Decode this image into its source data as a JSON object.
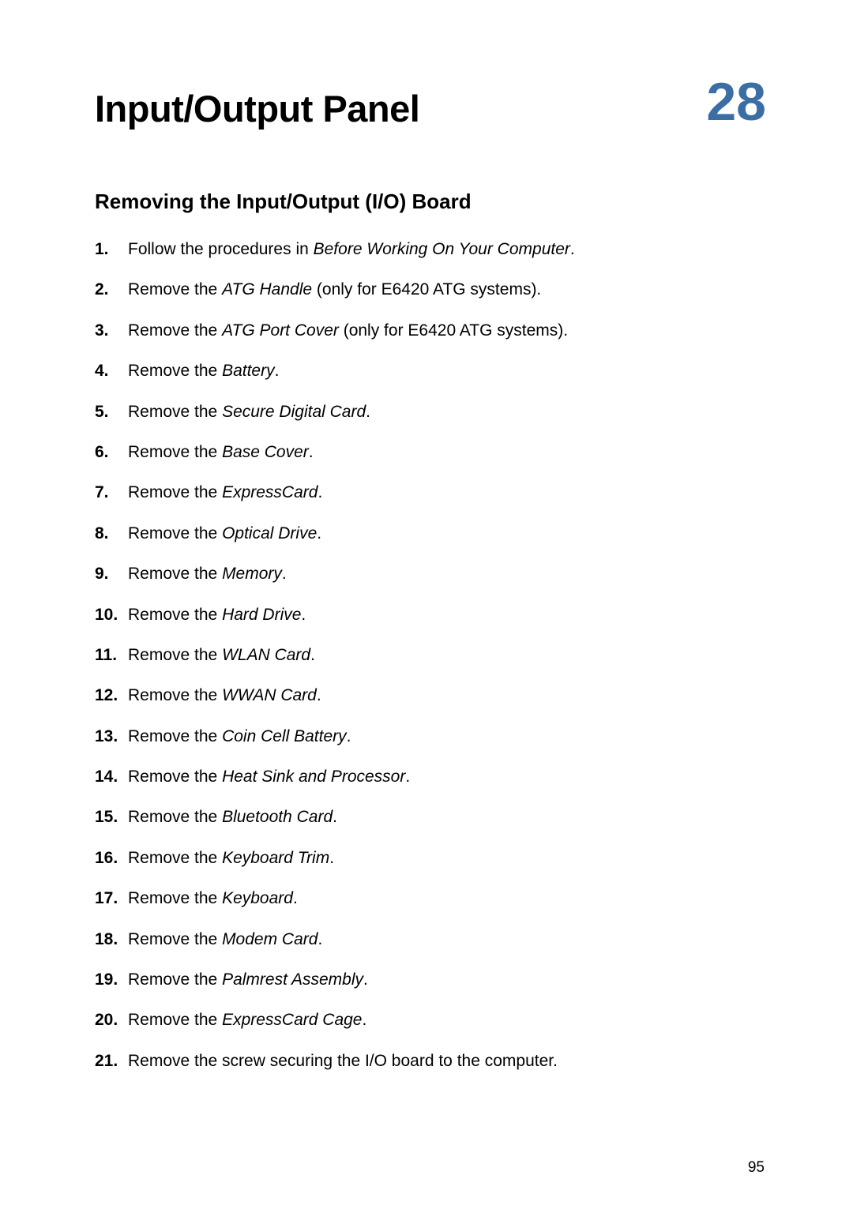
{
  "chapter": {
    "title": "Input/Output Panel",
    "number": "28"
  },
  "section": {
    "title": "Removing the Input/Output (I/O) Board"
  },
  "steps": [
    {
      "prefix": "Follow the procedures in ",
      "em": "Before Working On Your Computer",
      "suffix": "."
    },
    {
      "prefix": "Remove the ",
      "em": "ATG Handle",
      "suffix": " (only for E6420 ATG systems)."
    },
    {
      "prefix": "Remove the ",
      "em": "ATG Port Cover",
      "suffix": " (only for E6420 ATG systems)."
    },
    {
      "prefix": "Remove the ",
      "em": "Battery",
      "suffix": "."
    },
    {
      "prefix": "Remove the ",
      "em": "Secure Digital Card",
      "suffix": "."
    },
    {
      "prefix": "Remove the ",
      "em": "Base Cover",
      "suffix": "."
    },
    {
      "prefix": "Remove the ",
      "em": "ExpressCard",
      "suffix": "."
    },
    {
      "prefix": "Remove the ",
      "em": "Optical Drive",
      "suffix": "."
    },
    {
      "prefix": "Remove the ",
      "em": "Memory",
      "suffix": "."
    },
    {
      "prefix": "Remove the ",
      "em": "Hard Drive",
      "suffix": "."
    },
    {
      "prefix": "Remove the ",
      "em": "WLAN Card",
      "suffix": "."
    },
    {
      "prefix": "Remove the ",
      "em": "WWAN Card",
      "suffix": "."
    },
    {
      "prefix": "Remove the ",
      "em": "Coin Cell Battery",
      "suffix": "."
    },
    {
      "prefix": "Remove the ",
      "em": "Heat Sink and Processor",
      "suffix": "."
    },
    {
      "prefix": "Remove the ",
      "em": "Bluetooth Card",
      "suffix": "."
    },
    {
      "prefix": "Remove the ",
      "em": "Keyboard Trim",
      "suffix": "."
    },
    {
      "prefix": "Remove the ",
      "em": "Keyboard",
      "suffix": "."
    },
    {
      "prefix": "Remove the ",
      "em": "Modem Card",
      "suffix": "."
    },
    {
      "prefix": "Remove the ",
      "em": "Palmrest Assembly",
      "suffix": "."
    },
    {
      "prefix": "Remove the ",
      "em": "ExpressCard Cage",
      "suffix": "."
    },
    {
      "prefix": "Remove the screw securing the I/O board to the computer.",
      "em": "",
      "suffix": ""
    }
  ],
  "pageNumber": "95"
}
